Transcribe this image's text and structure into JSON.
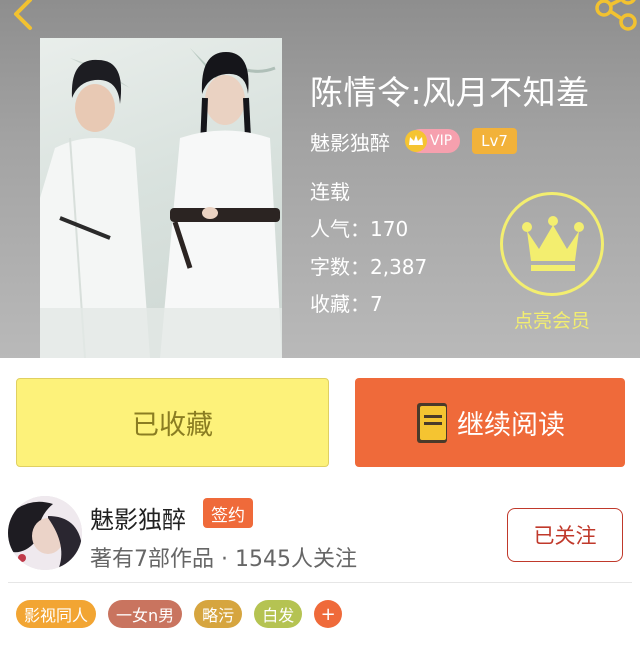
{
  "book": {
    "title": "陈情令:风月不知羞",
    "author": "魅影独醉",
    "vip_label": "VIP",
    "level": "Lv7",
    "status": "连载",
    "popularity_label": "人气：",
    "popularity": "170",
    "word_count_label": "字数：",
    "word_count": "2,387",
    "favorites_label": "收藏：",
    "favorites": "7"
  },
  "membership": {
    "label": "点亮会员"
  },
  "actions": {
    "favorite_label": "已收藏",
    "read_label": "继续阅读"
  },
  "author_card": {
    "name": "魅影独醉",
    "signed_label": "签约",
    "stats": "著有7部作品 · 1545人关注",
    "follow_label": "已关注"
  },
  "tags": [
    {
      "label": "影视同人",
      "color": "#f2a533"
    },
    {
      "label": "一女n男",
      "color": "#c9745f"
    },
    {
      "label": "略污",
      "color": "#d6a53f"
    },
    {
      "label": "白发",
      "color": "#b5c352"
    }
  ],
  "tag_add_label": "+",
  "colors": {
    "accent_orange": "#ef6a3a",
    "favorite_yellow": "#fdf27a",
    "member_yellow": "#f3ee6f",
    "follow_red": "#c0392b"
  },
  "icons": {
    "back": "back-arrow-icon",
    "share": "share-icon",
    "vip": "crown-icon",
    "member": "crown-icon",
    "read": "book-icon"
  }
}
